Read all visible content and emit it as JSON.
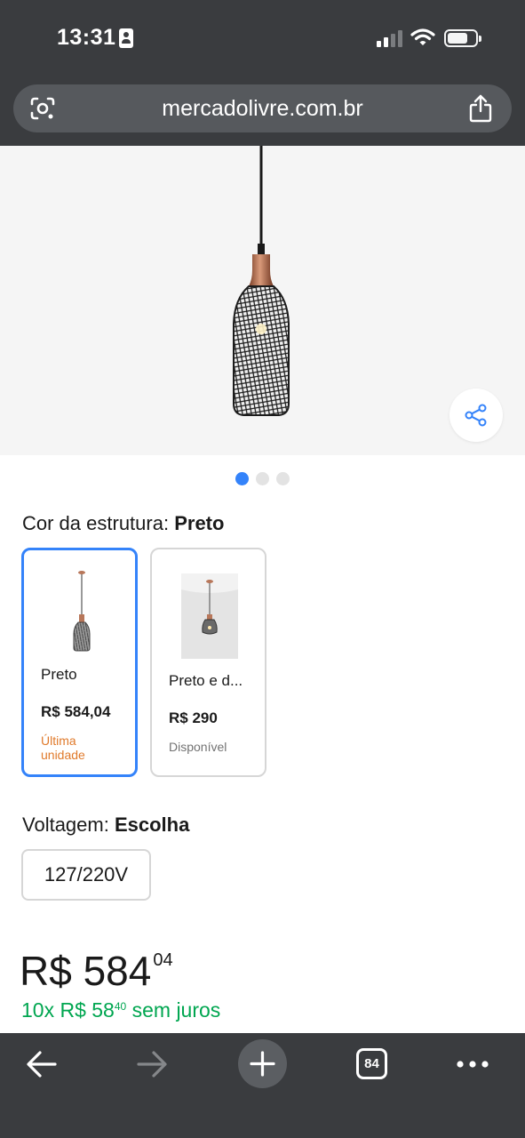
{
  "status_bar": {
    "time": "13:31",
    "icons": [
      "id-badge-icon",
      "signal-icon",
      "wifi-icon",
      "battery-icon"
    ]
  },
  "browser": {
    "url": "mercadolivre.com.br",
    "icons": [
      "lens-icon",
      "share-icon"
    ]
  },
  "gallery": {
    "image": "pendant-lamp-black-cage",
    "active_index": 0,
    "count": 3
  },
  "color_section": {
    "label": "Cor da estrutura:",
    "value": "Preto"
  },
  "variants": [
    {
      "name": "Preto",
      "price": "R$ 584,04",
      "status": "Última unidade",
      "status_color": "#e07a2b",
      "selected": true
    },
    {
      "name": "Preto e d...",
      "price": "R$ 290",
      "status": "Disponível",
      "status_color": "#737373",
      "selected": false
    }
  ],
  "voltage_section": {
    "label": "Voltagem:",
    "value": "Escolha",
    "option": "127/220V"
  },
  "price": {
    "main": "R$ 584",
    "cents": "04",
    "installments_prefix": "10x R$ 58",
    "installments_cents": "40",
    "installments_suffix": " sem juros"
  },
  "toolbar": {
    "tab_count": "84",
    "icons": [
      "back-arrow-icon",
      "forward-arrow-icon",
      "plus-icon",
      "tabs-icon",
      "more-icon"
    ]
  },
  "colors": {
    "accent": "#3483fa",
    "installments_green": "#00a650",
    "chrome_bg": "#3a3c3f"
  }
}
